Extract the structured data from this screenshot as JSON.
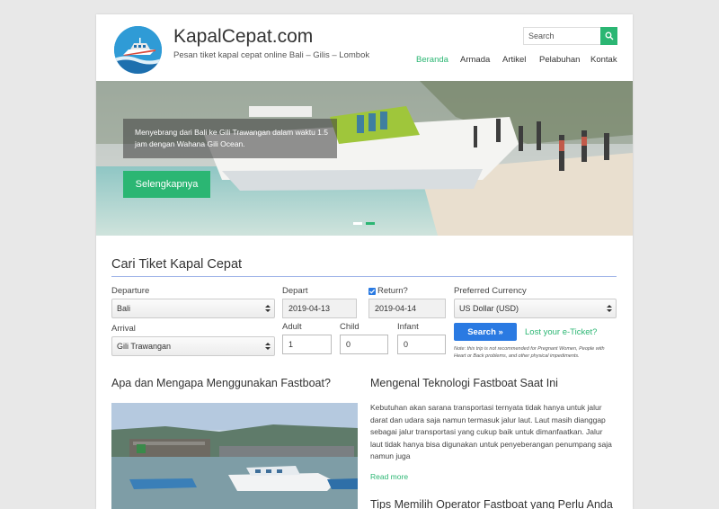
{
  "header": {
    "site_title": "KapalCepat.com",
    "site_description": "Pesan tiket kapal cepat online Bali – Gilis – Lombok",
    "logo_icon": "speedboat-logo-icon"
  },
  "search": {
    "placeholder": "Search",
    "button_icon": "search-icon"
  },
  "nav": {
    "items": [
      {
        "label": "Beranda",
        "active": true
      },
      {
        "label": "Armada",
        "active": false
      },
      {
        "label": "Artikel",
        "active": false
      },
      {
        "label": "Pelabuhan",
        "active": false
      },
      {
        "label": "Kontak",
        "active": false
      }
    ]
  },
  "hero": {
    "caption": "Menyebrang dari Bali ke Gili Trawangan dalam waktu 1.5 jam dengan Wahana Gili Ocean.",
    "button_label": "Selengkapnya",
    "slides": [
      {
        "active": false
      },
      {
        "active": true
      }
    ]
  },
  "booking": {
    "title": "Cari Tiket Kapal Cepat",
    "departure_label": "Departure",
    "departure_value": "Bali",
    "arrival_label": "Arrival",
    "arrival_value": "Gili Trawangan",
    "depart_label": "Depart",
    "depart_value": "2019-04-13",
    "return_label": "Return?",
    "return_checked": true,
    "return_value": "2019-04-14",
    "currency_label": "Preferred Currency",
    "currency_value": "US Dollar (USD)",
    "adult_label": "Adult",
    "adult_value": "1",
    "child_label": "Child",
    "child_value": "0",
    "infant_label": "Infant",
    "infant_value": "0",
    "search_button": "Search »",
    "lost_ticket_link": "Lost your e-Ticket?",
    "note": "Note: this trip is not recommended for Pregnant Women, People with Heart or Back problems, and other physical impediments."
  },
  "articles": [
    {
      "title": "Apa dan Mengapa Menggunakan Fastboat?"
    },
    {
      "title": "Mengenal Teknologi Fastboat Saat Ini",
      "excerpt": "Kebutuhan akan sarana transportasi ternyata tidak hanya untuk jalur darat dan udara saja namun termasuk jalur laut. Laut masih dianggap sebagai jalur transportasi yang cukup baik untuk dimanfaatkan. Jalur laut tidak hanya bisa digunakan untuk penyeberangan penumpang saja namun juga",
      "read_more": "Read more"
    },
    {
      "title": "Tips Memilih Operator Fastboat yang Perlu Anda"
    }
  ],
  "colors": {
    "accent_green": "#2bb673",
    "accent_blue": "#2a7ae2",
    "background": "#e8e8e8"
  }
}
